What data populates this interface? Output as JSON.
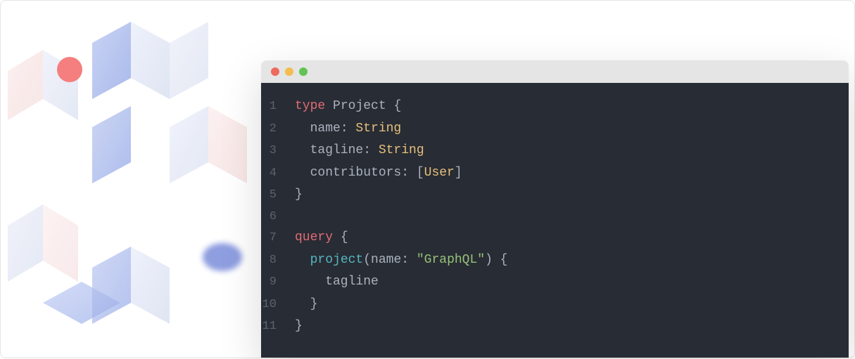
{
  "window": {
    "traffic_lights": [
      "red",
      "yellow",
      "green"
    ]
  },
  "code": {
    "lines": [
      {
        "n": 1,
        "tokens": [
          {
            "class": "tok-keyword",
            "text": "type"
          },
          {
            "class": "tok-default",
            "text": " Project "
          },
          {
            "class": "tok-punct",
            "text": "{"
          }
        ]
      },
      {
        "n": 2,
        "tokens": [
          {
            "class": "tok-default",
            "text": "  name"
          },
          {
            "class": "tok-punct",
            "text": ": "
          },
          {
            "class": "tok-type",
            "text": "String"
          }
        ]
      },
      {
        "n": 3,
        "tokens": [
          {
            "class": "tok-default",
            "text": "  tagline"
          },
          {
            "class": "tok-punct",
            "text": ": "
          },
          {
            "class": "tok-type",
            "text": "String"
          }
        ]
      },
      {
        "n": 4,
        "tokens": [
          {
            "class": "tok-default",
            "text": "  contributors"
          },
          {
            "class": "tok-punct",
            "text": ": ["
          },
          {
            "class": "tok-type",
            "text": "User"
          },
          {
            "class": "tok-punct",
            "text": "]"
          }
        ]
      },
      {
        "n": 5,
        "tokens": [
          {
            "class": "tok-punct",
            "text": "}"
          }
        ]
      },
      {
        "n": 6,
        "tokens": []
      },
      {
        "n": 7,
        "tokens": [
          {
            "class": "tok-keyword",
            "text": "query"
          },
          {
            "class": "tok-default",
            "text": " "
          },
          {
            "class": "tok-punct",
            "text": "{"
          }
        ]
      },
      {
        "n": 8,
        "tokens": [
          {
            "class": "tok-default",
            "text": "  "
          },
          {
            "class": "tok-func",
            "text": "project"
          },
          {
            "class": "tok-punct",
            "text": "(name: "
          },
          {
            "class": "tok-string",
            "text": "\"GraphQL\""
          },
          {
            "class": "tok-punct",
            "text": ") {"
          }
        ]
      },
      {
        "n": 9,
        "tokens": [
          {
            "class": "tok-default",
            "text": "    tagline"
          }
        ]
      },
      {
        "n": 10,
        "tokens": [
          {
            "class": "tok-punct",
            "text": "  }"
          }
        ]
      },
      {
        "n": 11,
        "tokens": [
          {
            "class": "tok-punct",
            "text": "}"
          }
        ]
      }
    ]
  }
}
